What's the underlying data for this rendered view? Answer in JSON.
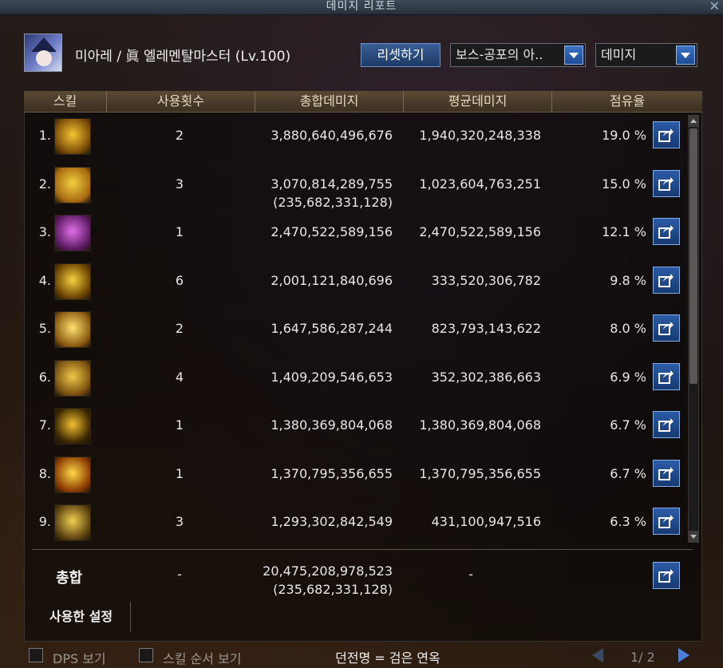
{
  "window": {
    "title": "데미지 리포트"
  },
  "header": {
    "character": "미아레 / 眞 엘레멘탈마스터 (Lv.100)",
    "reset_button": "리셋하기",
    "target_select": "보스-공포의 아..",
    "mode_select": "데미지"
  },
  "table": {
    "columns": [
      "스킬",
      "사용횟수",
      "총합데미지",
      "평균데미지",
      "점유율"
    ],
    "rows": [
      {
        "rank": "1.",
        "uses": "2",
        "total": "3,880,640,496,676",
        "total_extra": "",
        "avg": "1,940,320,248,338",
        "share": "19.0 %",
        "icon": "lightning-burst-icon",
        "c1": "#f5c531",
        "c2": "#7a4a08"
      },
      {
        "rank": "2.",
        "uses": "3",
        "total": "3,070,814,289,755",
        "total_extra": "(235,682,331,128)",
        "avg": "1,023,604,763,251",
        "share": "15.0 %",
        "icon": "star-explosion-icon",
        "c1": "#f0d040",
        "c2": "#a86a10"
      },
      {
        "rank": "3.",
        "uses": "1",
        "total": "2,470,522,589,156",
        "total_extra": "",
        "avg": "2,470,522,589,156",
        "share": "12.1 %",
        "icon": "dark-orb-icon",
        "c1": "#e070e8",
        "c2": "#5a1a60"
      },
      {
        "rank": "4.",
        "uses": "6",
        "total": "2,001,121,840,696",
        "total_extra": "",
        "avg": "333,520,306,782",
        "share": "9.8 %",
        "icon": "light-pillars-icon",
        "c1": "#f8d040",
        "c2": "#6a4200"
      },
      {
        "rank": "5.",
        "uses": "2",
        "total": "1,647,586,287,244",
        "total_extra": "",
        "avg": "823,793,143,622",
        "share": "8.0 %",
        "icon": "halo-flame-icon",
        "c1": "#ffe070",
        "c2": "#8a5a10"
      },
      {
        "rank": "6.",
        "uses": "4",
        "total": "1,409,209,546,653",
        "total_extra": "",
        "avg": "352,302,386,663",
        "share": "6.9 %",
        "icon": "crystal-cluster-icon",
        "c1": "#f0c848",
        "c2": "#7a5010"
      },
      {
        "rank": "7.",
        "uses": "1",
        "total": "1,380,369,804,068",
        "total_extra": "",
        "avg": "1,380,369,804,068",
        "share": "6.7 %",
        "icon": "black-hole-icon",
        "c1": "#f4c030",
        "c2": "#3a2600"
      },
      {
        "rank": "8.",
        "uses": "1",
        "total": "1,370,795,356,655",
        "total_extra": "",
        "avg": "1,370,795,356,655",
        "share": "6.7 %",
        "icon": "sun-flare-icon",
        "c1": "#ffd848",
        "c2": "#8a3a00"
      },
      {
        "rank": "9.",
        "uses": "3",
        "total": "1,293,302,842,549",
        "total_extra": "",
        "avg": "431,100,947,516",
        "share": "6.3 %",
        "icon": "arcane-slash-icon",
        "c1": "#f2d050",
        "c2": "#5a4010"
      }
    ],
    "summary": {
      "label": "총합",
      "uses": "-",
      "total": "20,475,208,978,523",
      "total_extra": "(235,682,331,128)",
      "avg": "-"
    }
  },
  "used_settings_tab": "사용한 설정",
  "footer": {
    "dps_toggle": "DPS 보기",
    "skill_order_toggle": "스킬 순서 보기",
    "dungeon_name": "던전명 = 검은 연옥",
    "page": "1/ 2"
  }
}
